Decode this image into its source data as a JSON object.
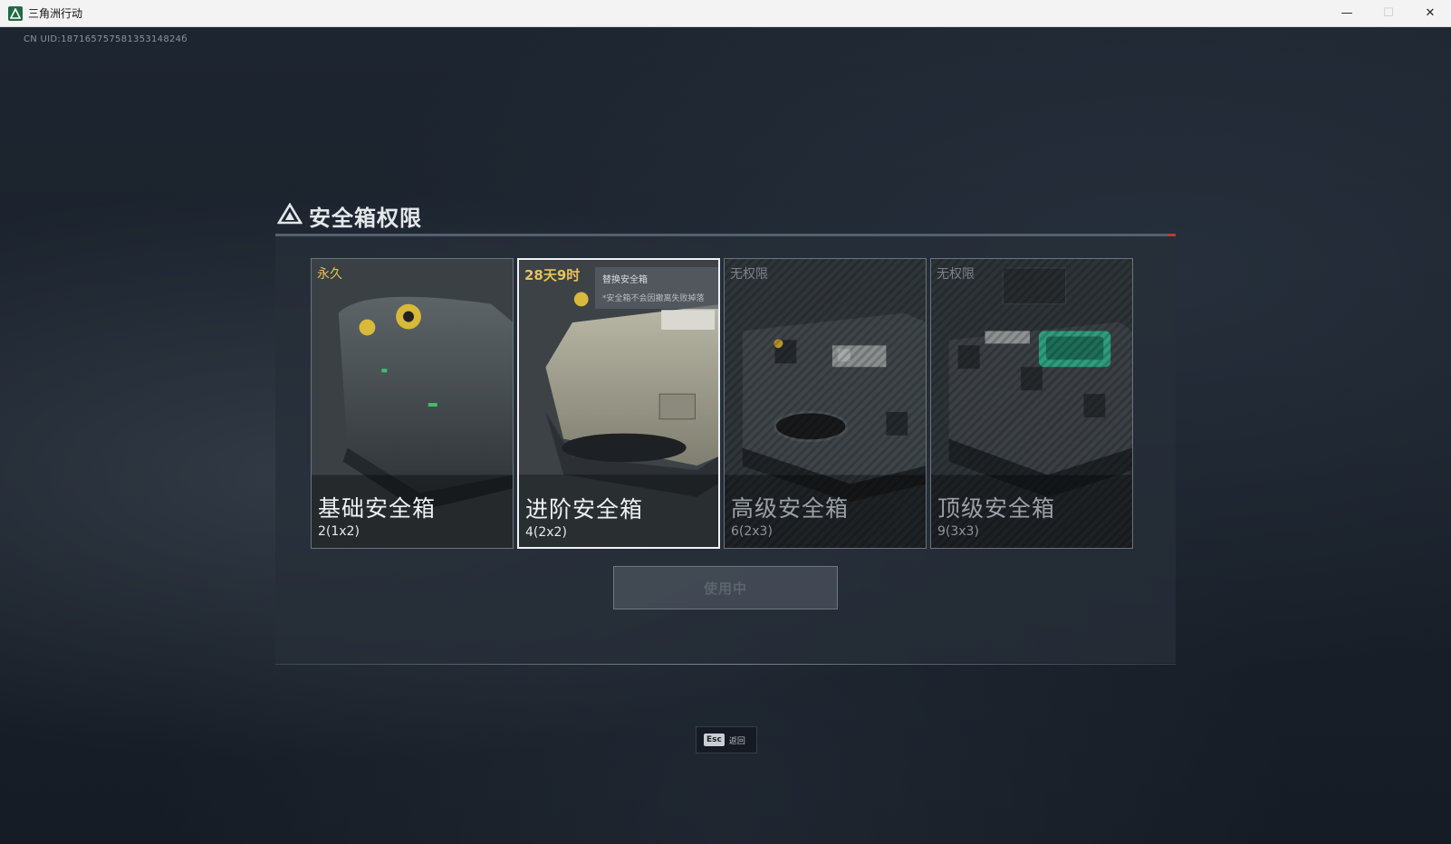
{
  "window": {
    "title": "三角洲行动",
    "minimize_glyph": "—",
    "maximize_glyph": "☐",
    "close_glyph": "✕"
  },
  "uid_text": "CN UID:18716575758135314824б",
  "panel": {
    "title": "安全箱权限",
    "title_icon": "triangle-logo-icon"
  },
  "cards": [
    {
      "status": "永久",
      "name": "基础安全箱",
      "capacity": "2(1x2)",
      "state": "owned"
    },
    {
      "status": "28天9时",
      "name": "进阶安全箱",
      "capacity": "4(2x2)",
      "state": "selected"
    },
    {
      "status": "无权限",
      "name": "高级安全箱",
      "capacity": "6(2x3)",
      "state": "locked"
    },
    {
      "status": "无权限",
      "name": "顶级安全箱",
      "capacity": "9(3x3)",
      "state": "locked"
    }
  ],
  "tooltip": {
    "title": "替换安全箱",
    "note": "*安全箱不会因撤离失败掉落"
  },
  "use_button": "使用中",
  "esc_hint": {
    "key": "Esc",
    "label": "返回"
  },
  "colors": {
    "gold": "#e7c15a",
    "accent_red": "#c0392b",
    "case_green": "#2f9e7e"
  }
}
